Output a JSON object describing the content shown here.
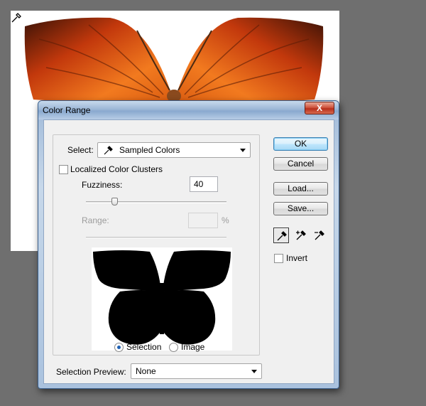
{
  "dialog": {
    "title": "Color Range",
    "close_symbol": "X"
  },
  "select": {
    "label": "Select:",
    "icon": "eyedropper-icon",
    "value": "Sampled Colors"
  },
  "localized": {
    "label": "Localized Color Clusters",
    "checked": false
  },
  "fuzziness": {
    "label": "Fuzziness:",
    "value": "40",
    "level_fraction": 0.2
  },
  "range": {
    "label": "Range:",
    "value": "",
    "unit": "%",
    "enabled": false
  },
  "preview_mode": {
    "options": [
      "Selection",
      "Image"
    ],
    "selected": "Selection"
  },
  "selection_preview": {
    "label": "Selection Preview:",
    "value": "None"
  },
  "buttons": {
    "ok": "OK",
    "cancel": "Cancel",
    "load": "Load...",
    "save": "Save..."
  },
  "tools": [
    "eyedropper-icon",
    "eyedropper-plus-icon",
    "eyedropper-minus-icon"
  ],
  "invert": {
    "label": "Invert",
    "checked": false
  },
  "colors": {
    "accent": "#3c7fb1",
    "wing_orange": "#f2691c",
    "wing_dark": "#3a1206",
    "mask_black": "#000000"
  }
}
